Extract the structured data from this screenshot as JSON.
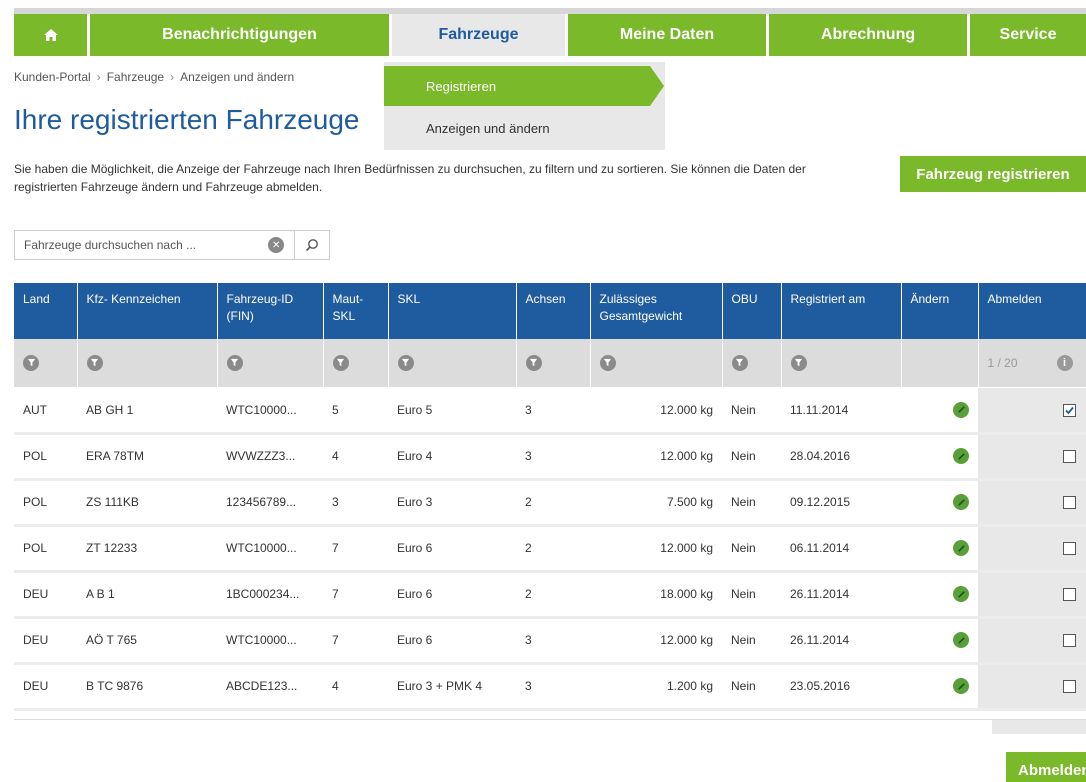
{
  "nav": {
    "home_icon": "home-icon",
    "items": [
      {
        "label": "Benachrichtigungen"
      },
      {
        "label": "Fahrzeuge"
      },
      {
        "label": "Meine Daten"
      },
      {
        "label": "Abrechnung"
      },
      {
        "label": "Service"
      }
    ],
    "active": "Fahrzeuge"
  },
  "dropdown": {
    "items": [
      {
        "label": "Registrieren"
      },
      {
        "label": "Anzeigen und ändern"
      }
    ]
  },
  "breadcrumb": [
    "Kunden-Portal",
    "Fahrzeuge",
    "Anzeigen und ändern"
  ],
  "page": {
    "title": "Ihre registrierten Fahrzeuge",
    "intro": "Sie haben die Möglichkeit, die Anzeige der Fahrzeuge nach Ihren Bedürfnissen zu durchsuchen, zu filtern und zu sortieren. Sie können die Daten der registrierten Fahrzeuge ändern und Fahrzeuge abmelden.",
    "register_button": "Fahrzeug registrieren",
    "deregister_button": "Abmelden"
  },
  "search": {
    "placeholder": "Fahrzeuge durchsuchen nach ...",
    "value": ""
  },
  "table": {
    "headers": [
      "Land",
      "Kfz- Kennzeichen",
      "Fahrzeug-ID (FIN)",
      "Maut-SKL",
      "SKL",
      "Achsen",
      "Zulässiges Gesamtgewicht",
      "OBU",
      "Registriert am",
      "Ändern",
      "Abmelden"
    ],
    "pager": "1 / 20",
    "rows": [
      {
        "land": "AUT",
        "kennzeichen": "AB GH 1",
        "fin": "WTC10000...",
        "maut_skl": "5",
        "skl": "Euro 5",
        "achsen": "3",
        "gewicht": "12.000 kg",
        "obu": "Nein",
        "registriert": "11.11.2014",
        "checked": true
      },
      {
        "land": "POL",
        "kennzeichen": "ERA 78TM",
        "fin": "WVWZZZ3...",
        "maut_skl": "4",
        "skl": "Euro 4",
        "achsen": "3",
        "gewicht": "12.000 kg",
        "obu": "Nein",
        "registriert": "28.04.2016",
        "checked": false
      },
      {
        "land": "POL",
        "kennzeichen": "ZS 111KB",
        "fin": "123456789...",
        "maut_skl": "3",
        "skl": "Euro 3",
        "achsen": "2",
        "gewicht": "7.500 kg",
        "obu": "Nein",
        "registriert": "09.12.2015",
        "checked": false
      },
      {
        "land": "POL",
        "kennzeichen": "ZT 12233",
        "fin": "WTC10000...",
        "maut_skl": "7",
        "skl": "Euro 6",
        "achsen": "2",
        "gewicht": "12.000 kg",
        "obu": "Nein",
        "registriert": "06.11.2014",
        "checked": false
      },
      {
        "land": "DEU",
        "kennzeichen": "A B 1",
        "fin": "1BC000234...",
        "maut_skl": "7",
        "skl": "Euro 6",
        "achsen": "2",
        "gewicht": "18.000 kg",
        "obu": "Nein",
        "registriert": "26.11.2014",
        "checked": false
      },
      {
        "land": "DEU",
        "kennzeichen": "AÖ T 765",
        "fin": "WTC10000...",
        "maut_skl": "7",
        "skl": "Euro 6",
        "achsen": "3",
        "gewicht": "12.000 kg",
        "obu": "Nein",
        "registriert": "26.11.2014",
        "checked": false
      },
      {
        "land": "DEU",
        "kennzeichen": "B TC 9876",
        "fin": "ABCDE123...",
        "maut_skl": "4",
        "skl": "Euro 3 + PMK 4",
        "achsen": "3",
        "gewicht": "1.200 kg",
        "obu": "Nein",
        "registriert": "23.05.2016",
        "checked": false
      }
    ]
  },
  "colors": {
    "green": "#7ab929",
    "blue": "#1f5b9f",
    "grey": "#e8e8e8"
  }
}
